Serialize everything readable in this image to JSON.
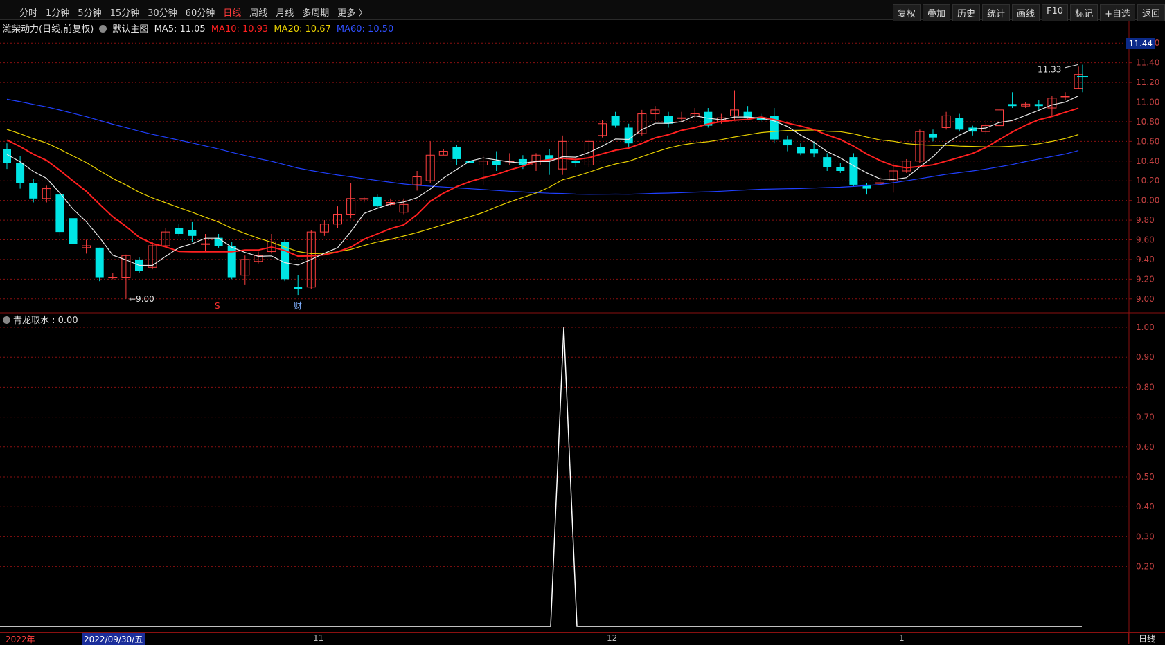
{
  "toolbar": {
    "periods": [
      "分时",
      "1分钟",
      "5分钟",
      "15分钟",
      "30分钟",
      "60分钟",
      "日线",
      "周线",
      "月线",
      "多周期",
      "更多 〉"
    ],
    "active_period": "日线",
    "right_buttons": [
      "复权",
      "叠加",
      "历史",
      "统计",
      "画线",
      "F10",
      "标记",
      "+自选",
      "返回"
    ]
  },
  "legend": {
    "stock": "潍柴动力(日线,前复权)",
    "main_label": "默认主图",
    "ma5": "MA5: 11.05",
    "ma10": "MA10: 10.93",
    "ma20": "MA20: 10.67",
    "ma60": "MA60: 10.50"
  },
  "colors": {
    "up": "#ff4040",
    "down": "#00e5e5",
    "ma5": "#e8e8e8",
    "ma10": "#ff2020",
    "ma20": "#e8d000",
    "ma60": "#2040ff",
    "grid": "#8a1010",
    "indicator": "#ffffff"
  },
  "price_axis": {
    "labels": [
      "11.60",
      "11.40",
      "11.20",
      "11.00",
      "10.80",
      "10.60",
      "10.40",
      "10.20",
      "10.00",
      "9.80",
      "9.60",
      "9.40",
      "9.20",
      "9.00"
    ],
    "current": "11.44"
  },
  "annotations": {
    "high_label": "11.33",
    "low_label": "9.00",
    "marker_s": "S",
    "marker_cai": "财"
  },
  "indicator": {
    "legend": "青龙取水 : 0.00",
    "axis_labels": [
      "1.00",
      "0.90",
      "0.80",
      "0.70",
      "0.60",
      "0.50",
      "0.40",
      "0.30",
      "0.20"
    ]
  },
  "bottom": {
    "year": "2022年",
    "cursor_date": "2022/09/30/五",
    "months": [
      "11",
      "12",
      "1"
    ],
    "period_tab": "日线"
  },
  "chart_data": {
    "type": "candlestick",
    "ylim": [
      8.9,
      11.7
    ],
    "candles": [
      [
        10.52,
        10.38,
        10.58,
        10.32
      ],
      [
        10.38,
        10.18,
        10.45,
        10.12
      ],
      [
        10.18,
        10.02,
        10.22,
        9.98
      ],
      [
        10.02,
        10.12,
        10.15,
        9.98
      ],
      [
        10.06,
        9.68,
        10.08,
        9.64
      ],
      [
        9.82,
        9.56,
        9.84,
        9.52
      ],
      [
        9.52,
        9.54,
        9.6,
        9.46
      ],
      [
        9.52,
        9.22,
        9.52,
        9.18
      ],
      [
        9.22,
        9.22,
        9.26,
        9.2
      ],
      [
        9.22,
        9.44,
        9.45,
        9.0
      ],
      [
        9.4,
        9.28,
        9.42,
        9.26
      ],
      [
        9.32,
        9.54,
        9.58,
        9.3
      ],
      [
        9.54,
        9.68,
        9.72,
        9.52
      ],
      [
        9.72,
        9.66,
        9.76,
        9.64
      ],
      [
        9.7,
        9.64,
        9.78,
        9.58
      ],
      [
        9.56,
        9.56,
        9.66,
        9.48
      ],
      [
        9.62,
        9.54,
        9.66,
        9.52
      ],
      [
        9.54,
        9.22,
        9.58,
        9.2
      ],
      [
        9.24,
        9.4,
        9.44,
        9.14
      ],
      [
        9.38,
        9.44,
        9.48,
        9.36
      ],
      [
        9.48,
        9.58,
        9.66,
        9.46
      ],
      [
        9.58,
        9.2,
        9.6,
        9.18
      ],
      [
        9.12,
        9.1,
        9.24,
        9.04
      ],
      [
        9.12,
        9.68,
        9.7,
        9.1
      ],
      [
        9.68,
        9.76,
        9.8,
        9.64
      ],
      [
        9.76,
        9.86,
        9.94,
        9.72
      ],
      [
        9.86,
        10.02,
        10.18,
        9.82
      ],
      [
        10.02,
        10.02,
        10.04,
        9.98
      ],
      [
        10.04,
        9.94,
        10.06,
        9.92
      ],
      [
        9.96,
        9.98,
        10.02,
        9.94
      ],
      [
        9.88,
        9.96,
        10.02,
        9.86
      ],
      [
        10.16,
        10.24,
        10.3,
        10.1
      ],
      [
        10.2,
        10.46,
        10.6,
        10.18
      ],
      [
        10.46,
        10.5,
        10.52,
        10.46
      ],
      [
        10.54,
        10.42,
        10.56,
        10.36
      ],
      [
        10.4,
        10.38,
        10.44,
        10.34
      ],
      [
        10.36,
        10.4,
        10.46,
        10.16
      ],
      [
        10.4,
        10.36,
        10.5,
        10.3
      ],
      [
        10.4,
        10.4,
        10.48,
        10.36
      ],
      [
        10.42,
        10.36,
        10.46,
        10.32
      ],
      [
        10.36,
        10.46,
        10.48,
        10.3
      ],
      [
        10.46,
        10.4,
        10.52,
        10.26
      ],
      [
        10.32,
        10.6,
        10.66,
        10.26
      ],
      [
        10.4,
        10.38,
        10.44,
        10.34
      ],
      [
        10.36,
        10.6,
        10.62,
        10.34
      ],
      [
        10.66,
        10.78,
        10.82,
        10.64
      ],
      [
        10.86,
        10.76,
        10.9,
        10.74
      ],
      [
        10.74,
        10.58,
        10.78,
        10.54
      ],
      [
        10.68,
        10.88,
        10.92,
        10.66
      ],
      [
        10.88,
        10.92,
        10.96,
        10.82
      ],
      [
        10.86,
        10.78,
        10.9,
        10.74
      ],
      [
        10.84,
        10.84,
        10.9,
        10.8
      ],
      [
        10.86,
        10.88,
        10.94,
        10.84
      ],
      [
        10.9,
        10.76,
        10.94,
        10.74
      ],
      [
        10.8,
        10.84,
        10.88,
        10.78
      ],
      [
        10.86,
        10.92,
        11.12,
        10.82
      ],
      [
        10.9,
        10.84,
        10.96,
        10.82
      ],
      [
        10.84,
        10.82,
        10.88,
        10.8
      ],
      [
        10.86,
        10.62,
        10.94,
        10.58
      ],
      [
        10.62,
        10.56,
        10.66,
        10.5
      ],
      [
        10.54,
        10.48,
        10.58,
        10.46
      ],
      [
        10.52,
        10.48,
        10.6,
        10.44
      ],
      [
        10.44,
        10.34,
        10.48,
        10.3
      ],
      [
        10.34,
        10.3,
        10.38,
        10.28
      ],
      [
        10.44,
        10.16,
        10.48,
        10.14
      ],
      [
        10.16,
        10.12,
        10.18,
        10.06
      ],
      [
        10.18,
        10.18,
        10.24,
        10.16
      ],
      [
        10.2,
        10.3,
        10.38,
        10.08
      ],
      [
        10.3,
        10.4,
        10.42,
        10.28
      ],
      [
        10.4,
        10.7,
        10.72,
        10.38
      ],
      [
        10.68,
        10.64,
        10.72,
        10.6
      ],
      [
        10.74,
        10.86,
        10.9,
        10.72
      ],
      [
        10.84,
        10.72,
        10.88,
        10.7
      ],
      [
        10.74,
        10.7,
        10.76,
        10.66
      ],
      [
        10.7,
        10.76,
        10.82,
        10.68
      ],
      [
        10.76,
        10.92,
        10.94,
        10.74
      ],
      [
        10.98,
        10.96,
        11.1,
        10.94
      ],
      [
        10.96,
        10.98,
        11.0,
        10.94
      ],
      [
        10.98,
        10.96,
        11.02,
        10.92
      ],
      [
        10.94,
        11.04,
        11.06,
        10.86
      ],
      [
        11.06,
        11.06,
        11.1,
        11.02
      ],
      [
        11.14,
        11.28,
        11.36,
        11.14
      ]
    ]
  }
}
